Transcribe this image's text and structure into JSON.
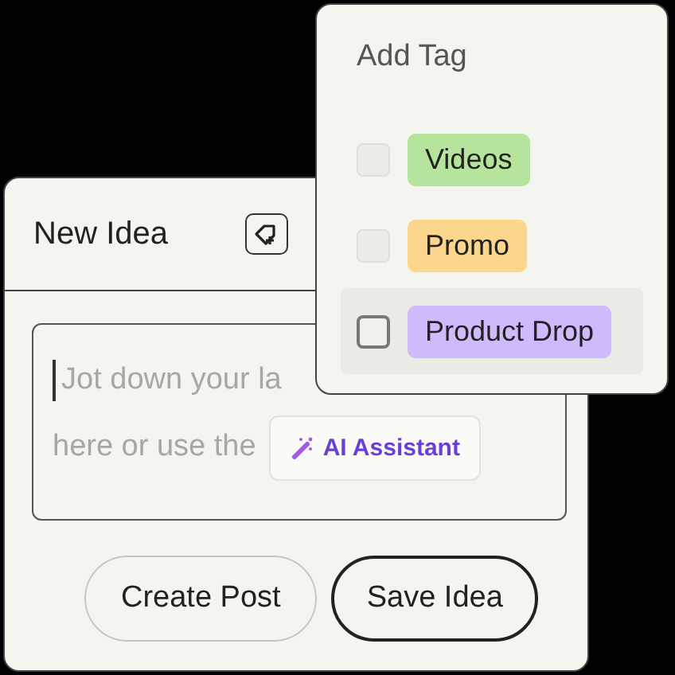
{
  "card": {
    "title": "New Idea",
    "field": {
      "lines": [
        "Jot down your la",
        "here or use the"
      ],
      "assistant_button": "AI Assistant"
    },
    "buttons": [
      {
        "label": "Create Post",
        "kind": "secondary"
      },
      {
        "label": "Save Idea",
        "kind": "primary"
      }
    ]
  },
  "tag_menu": {
    "title": "Add Tag",
    "items": [
      {
        "label": "Videos",
        "color": "#b7e49c",
        "checked": false,
        "highlighted": false
      },
      {
        "label": "Promo",
        "color": "#fdd68d",
        "checked": false,
        "highlighted": false
      },
      {
        "label": "Product Drop",
        "color": "#cfbafc",
        "checked": false,
        "highlighted": true
      }
    ]
  }
}
